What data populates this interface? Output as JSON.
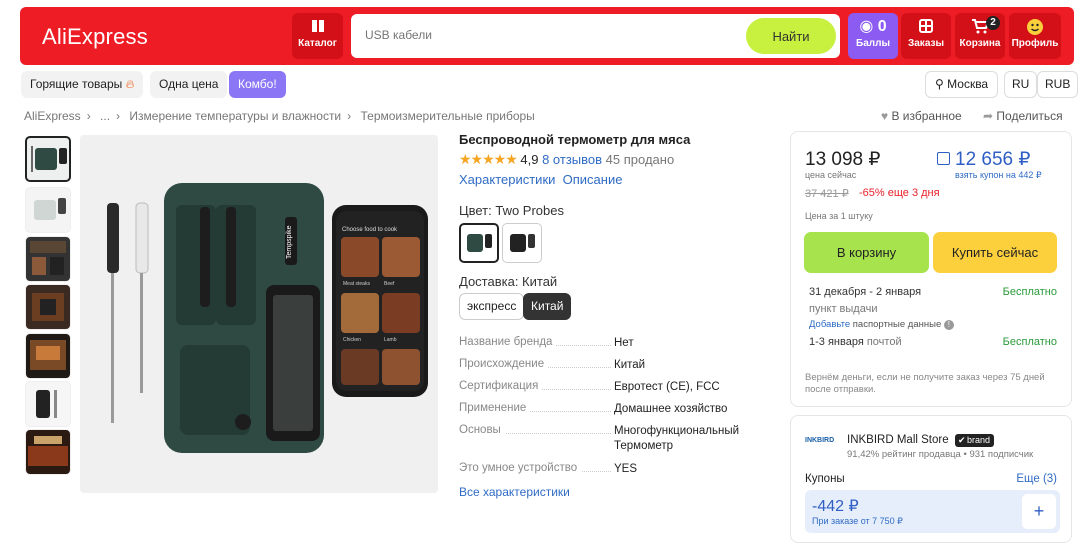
{
  "header": {
    "logo": "AliExpress",
    "catalog_label": "Каталог",
    "search_placeholder": "USB кабели",
    "search_button": "Найти",
    "bonus_count": "0",
    "bonus_label": "Баллы",
    "orders_label": "Заказы",
    "cart_label": "Корзина",
    "cart_count": "2",
    "profile_label": "Профиль"
  },
  "nav": {
    "hot": "Горящие товары",
    "one_price": "Одна цена",
    "combo": "Комбо!",
    "city": "Москва",
    "lang": "RU",
    "currency": "RUB"
  },
  "breadcrumb": [
    "AliExpress",
    "...",
    "Измерение температуры и влажности",
    "Термоизмерительные приборы"
  ],
  "actions": {
    "favorite": "В избранное",
    "share": "Поделиться"
  },
  "product": {
    "title": "Беспроводной термометр для мяса",
    "rating": "4,9",
    "reviews": "8 отзывов",
    "sold": "45 продано",
    "tab_specs": "Характеристики",
    "tab_desc": "Описание",
    "color_label": "Цвет: Two Probes",
    "delivery_label": "Доставка: Китай",
    "delivery_express": "экспресс",
    "delivery_china": "Китай",
    "image_device_text": "Tempspike",
    "phone_header": "Choose food to cook",
    "phone_items": [
      "Meat steaks",
      "Beef",
      "Chicken",
      "Lamb"
    ],
    "specs": [
      {
        "k": "Название бренда",
        "v": "Нет"
      },
      {
        "k": "Происхождение",
        "v": "Китай"
      },
      {
        "k": "Сертификация",
        "v": "Евротест (CE), FCC"
      },
      {
        "k": "Применение",
        "v": "Домашнее хозяйство"
      },
      {
        "k": "Основы",
        "v": "Многофункциональный Термометр"
      },
      {
        "k": "Это умное устройство",
        "v": "YES"
      }
    ],
    "all_specs": "Все характеристики"
  },
  "buy": {
    "price": "13 098 ₽",
    "price_sub": "цена сейчас",
    "coupon_price": "12 656 ₽",
    "coupon_sub": "взять купон на 442 ₽",
    "old_price": "37 421 ₽",
    "discount": "-65% еще 3 дня",
    "per_unit": "Цена за 1 штуку",
    "add_to_cart": "В корзину",
    "buy_now": "Купить сейчас",
    "delivery1_date": "31 декабря - 2 января",
    "delivery1_place": "пункт выдачи",
    "delivery1_note_link": "Добавьте",
    "delivery1_note": "паспортные данные",
    "delivery1_price": "Бесплатно",
    "delivery2_date": "1-3 января",
    "delivery2_place": "почтой",
    "delivery2_price": "Бесплатно",
    "refund": "Вернём деньги, если не получите заказ через 75 дней после отправки."
  },
  "store": {
    "logo": "INKBIRD",
    "name": "INKBIRD Mall Store",
    "brand": "brand",
    "stats": "91,42% рейтинг продавца • 931 подписчик",
    "coupons_label": "Купоны",
    "coupons_more": "Еще (3)",
    "coupon_amount": "-442 ₽",
    "coupon_cond": "При заказе от 7 750 ₽"
  },
  "colors": {
    "brand_red": "#ee1c25",
    "accent_green": "#c8f03e",
    "purple": "#8b77f5",
    "cart_green": "#a6e34d",
    "buy_yellow": "#fcd03c",
    "link_blue": "#2f6bc4"
  }
}
